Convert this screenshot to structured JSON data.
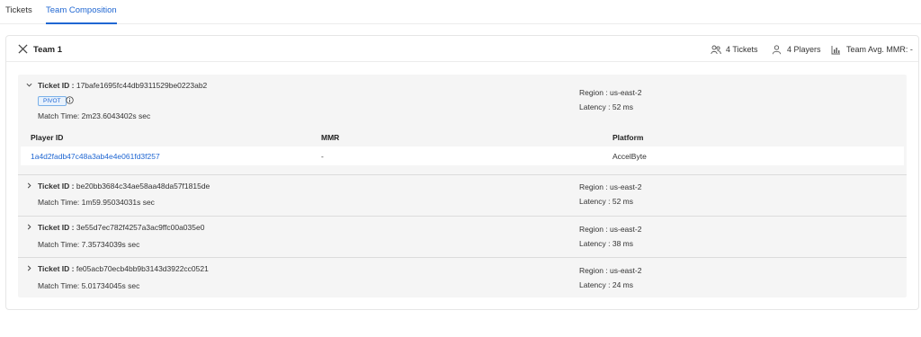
{
  "tabs": [
    {
      "label": "Tickets"
    },
    {
      "label": "Team Composition"
    }
  ],
  "team": {
    "title": "Team 1",
    "tickets_count": "4 Tickets",
    "players_count": "4 Players",
    "avg_mmr": "Team Avg. MMR: -"
  },
  "tickets": [
    {
      "id_label": "Ticket ID :",
      "id": "17bafe1695fc44db9311529be0223ab2",
      "badge": "PIVOT",
      "match_time": "Match Time: 2m23.6043402s sec",
      "region": "Region : us-east-2",
      "latency": "Latency : 52 ms",
      "expanded": true
    },
    {
      "id_label": "Ticket ID :",
      "id": "be20bb3684c34ae58aa48da57f1815de",
      "match_time": "Match Time: 1m59.95034031s sec",
      "region": "Region : us-east-2",
      "latency": "Latency : 52 ms",
      "expanded": false
    },
    {
      "id_label": "Ticket ID :",
      "id": "3e55d7ec782f4257a3ac9ffc00a035e0",
      "match_time": "Match Time: 7.35734039s sec",
      "region": "Region : us-east-2",
      "latency": "Latency : 38 ms",
      "expanded": false
    },
    {
      "id_label": "Ticket ID :",
      "id": "fe05acb70ecb4bb9b3143d3922cc0521",
      "match_time": "Match Time: 5.01734045s sec",
      "region": "Region : us-east-2",
      "latency": "Latency : 24 ms",
      "expanded": false
    }
  ],
  "players_table": {
    "headers": [
      "Player ID",
      "MMR",
      "Platform"
    ],
    "rows": [
      [
        "1a4d2fadb47c48a3ab4e4e061fd3f257",
        "-",
        "AccelByte"
      ]
    ]
  },
  "colors": {
    "accent": "#2067d2",
    "panel_bg": "#f5f5f5",
    "border": "#e6e6e6"
  },
  "icons": {
    "team": "crossed-swords-icon",
    "tickets": "people-group-icon",
    "players": "person-icon",
    "mmr": "bar-chart-icon",
    "expand": "chevron-icon",
    "info": "info-icon"
  }
}
